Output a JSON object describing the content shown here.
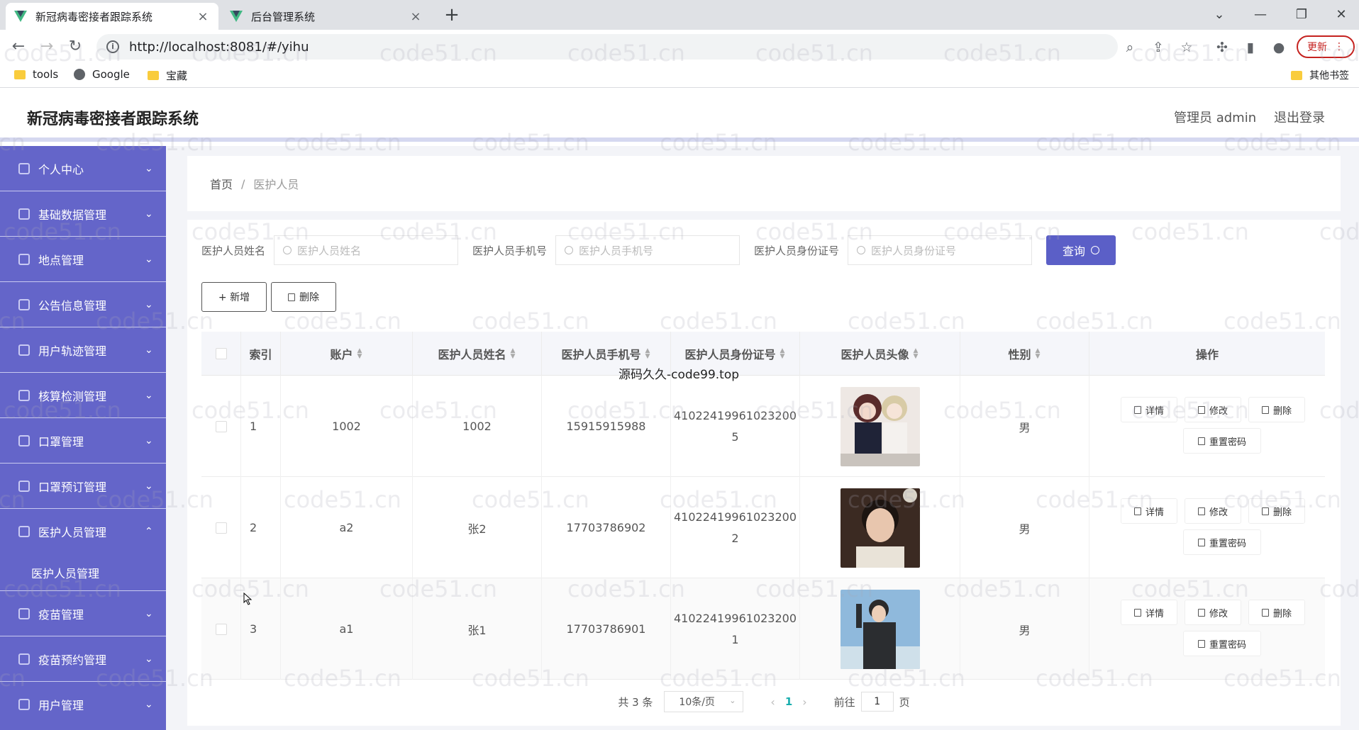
{
  "browser": {
    "tabs": [
      {
        "title": "新冠病毒密接者跟踪系统",
        "close": "×"
      },
      {
        "title": "后台管理系统",
        "close": "×"
      }
    ],
    "new_tab": "+",
    "window_controls": {
      "minimize": "—",
      "restore": "❐",
      "close": "✕",
      "dropdown": "⌄"
    },
    "url": "http://localhost:8081/#/yihu",
    "update_label": "更新",
    "bookmarks": [
      "tools",
      "Google",
      "宝藏"
    ],
    "other_bookmarks": "其他书签"
  },
  "header": {
    "title": "新冠病毒密接者跟踪系统",
    "admin": "管理员 admin",
    "logout": "退出登录"
  },
  "sidebar": {
    "items": [
      {
        "label": "个人中心",
        "chevron": "⌄"
      },
      {
        "label": "基础数据管理",
        "chevron": "⌄"
      },
      {
        "label": "地点管理",
        "chevron": "⌄"
      },
      {
        "label": "公告信息管理",
        "chevron": "⌄"
      },
      {
        "label": "用户轨迹管理",
        "chevron": "⌄"
      },
      {
        "label": "核算检测管理",
        "chevron": "⌄"
      },
      {
        "label": "口罩管理",
        "chevron": "⌄"
      },
      {
        "label": "口罩预订管理",
        "chevron": "⌄"
      },
      {
        "label": "医护人员管理",
        "chevron": "⌃"
      },
      {
        "label": "疫苗管理",
        "chevron": "⌄"
      },
      {
        "label": "疫苗预约管理",
        "chevron": "⌄"
      },
      {
        "label": "用户管理",
        "chevron": "⌄"
      }
    ],
    "sub_item": "医护人员管理"
  },
  "breadcrumb": {
    "home": "首页",
    "sep": "/",
    "current": "医护人员"
  },
  "search": {
    "name_label": "医护人员姓名",
    "name_placeholder": "医护人员姓名",
    "phone_label": "医护人员手机号",
    "phone_placeholder": "医护人员手机号",
    "id_label": "医护人员身份证号",
    "id_placeholder": "医护人员身份证号",
    "button": "查询"
  },
  "actions": {
    "add": "+ 新增",
    "delete": "删除"
  },
  "table": {
    "columns": [
      "索引",
      "账户",
      "医护人员姓名",
      "医护人员手机号",
      "医护人员身份证号",
      "医护人员头像",
      "性别",
      "操作"
    ],
    "rows": [
      {
        "index": "1",
        "account": "1002",
        "name": "1002",
        "phone": "15915915988",
        "id_line1": "41022419961023200",
        "id_line2": "5",
        "gender": "男"
      },
      {
        "index": "2",
        "account": "a2",
        "name": "张2",
        "phone": "17703786902",
        "id_line1": "41022419961023200",
        "id_line2": "2",
        "gender": "男"
      },
      {
        "index": "3",
        "account": "a1",
        "name": "张1",
        "phone": "17703786901",
        "id_line1": "41022419961023200",
        "id_line2": "1",
        "gender": "男"
      }
    ],
    "ops": {
      "detail": "详情",
      "edit": "修改",
      "delete": "删除",
      "reset": "重置密码"
    }
  },
  "pagination": {
    "total": "共 3 条",
    "size": "10条/页",
    "prev": "‹",
    "current": "1",
    "next": "›",
    "goto": "前往",
    "goto_value": "1",
    "page_unit": "页"
  },
  "watermark": {
    "center": "源码久久-code99.top",
    "repeat": "code51.cn"
  },
  "colors": {
    "sidebar": "#6465c9",
    "primary_button": "#5b5fc7",
    "page_active": "#1aaeae"
  }
}
